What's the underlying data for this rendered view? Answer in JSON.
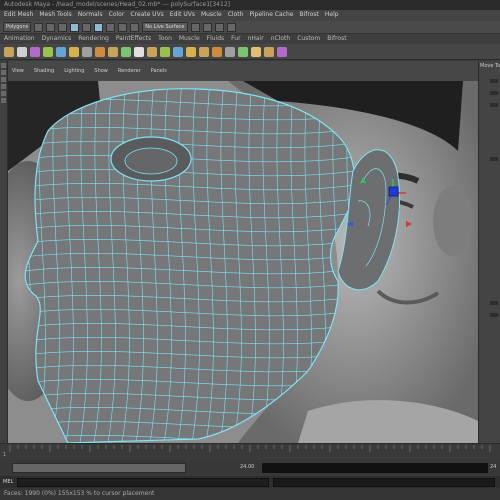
{
  "window": {
    "title": "Autodesk Maya - /head_model/scenes/Head_02.mb* --- polySurface1[3412]"
  },
  "menubar": {
    "items": [
      "Edit Mesh",
      "Mesh Tools",
      "Normals",
      "Color",
      "Create UVs",
      "Edit UVs",
      "Muscle",
      "Cloth",
      "Pipeline Cache",
      "Bifrost",
      "Help"
    ]
  },
  "statusline": {
    "mode": "Polygons",
    "surface_field": "No Live Surface"
  },
  "shelf": {
    "tabs": [
      "Animation",
      "Dynamics",
      "Rendering",
      "PaintEffects",
      "Toon",
      "Muscle",
      "Fluids",
      "Fur",
      "nHair",
      "nCloth",
      "Custom",
      "Bifrost"
    ],
    "icon_colors": [
      "#c9a35a",
      "#d0d0d0",
      "#b46ac8",
      "#9bc04e",
      "#64a4d6",
      "#d6b34a",
      "#a0a0a0",
      "#d08c3c",
      "#c9a35a",
      "#7cc470",
      "#e0e0e0",
      "#c9a35a",
      "#9bc04e",
      "#64a4d6",
      "#d6b34a",
      "#c9a35a",
      "#d08c3c",
      "#a0a0a0",
      "#7cc470",
      "#e0c070",
      "#c9a35a",
      "#b46ac8"
    ]
  },
  "viewport": {
    "menu": [
      "View",
      "Shading",
      "Lighting",
      "Show",
      "Renderer",
      "Panels"
    ],
    "wire_color": "#7fe3f5",
    "mesh_color": "#757779",
    "background_color": "#8a8a8a"
  },
  "channel_box": {
    "title": "Move Tool"
  },
  "timeline": {
    "start": "1",
    "end": "24",
    "range_end": "24.00"
  },
  "command_line": {
    "label": "MEL"
  },
  "help_line": {
    "text": "Faces: 1990 (0%) 155x153 % to cursor placement"
  }
}
